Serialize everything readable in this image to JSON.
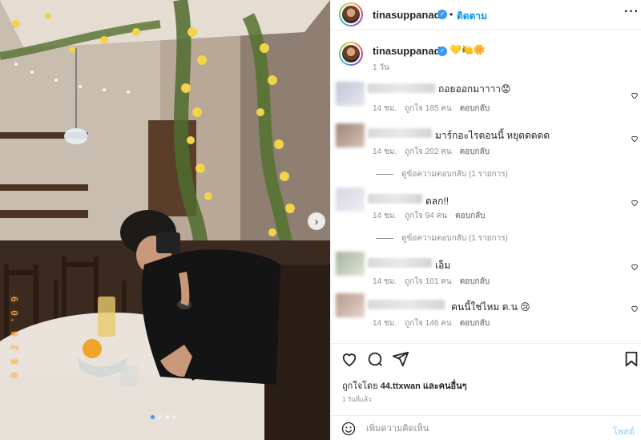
{
  "post": {
    "username": "tinasuppanad",
    "follow_label": "ติดตาม",
    "separator": "•",
    "more_icon": "more-horizontal-icon",
    "caption_emoji": "💛🍋🌼",
    "caption_time": "1 วัน",
    "photo_date_stamp": "0 8 2 8 '0 9",
    "carousel_count": 4,
    "carousel_active_index": 0
  },
  "comments": [
    {
      "text": "ถอยออกมาาาา😟",
      "time": "14 ชม.",
      "likes": "ถูกใจ 185 คน",
      "reply": "ตอบกลับ",
      "view_replies": ""
    },
    {
      "text": "มาร์กอะไรตอนนี้ หยุดดดดด",
      "time": "14 ชม.",
      "likes": "ถูกใจ 202 คน",
      "reply": "ตอบกลับ",
      "view_replies": "ดูข้อความตอบกลับ (1 รายการ)"
    },
    {
      "text": "ตลก!!",
      "time": "14 ชม.",
      "likes": "ถูกใจ 94 คน",
      "reply": "ตอบกลับ",
      "view_replies": "ดูข้อความตอบกลับ (1 รายการ)"
    },
    {
      "text": "เอ็ม",
      "time": "14 ชม.",
      "likes": "ถูกใจ 101 คน",
      "reply": "ตอบกลับ",
      "view_replies": ""
    },
    {
      "text": "คนนี้ใช่ไหม ต.น 😢",
      "time": "14 ชม.",
      "likes": "ถูกใจ 146 คน",
      "reply": "ตอบกลับ",
      "view_replies": ""
    }
  ],
  "footer": {
    "liked_by_prefix": "ถูกใจโดย",
    "liked_by_user": "44.ttxwan",
    "liked_by_suffix": "และคนอื่นๆ",
    "post_time": "1 วันที่แล้ว",
    "comment_placeholder": "เพิ่มความคิดเห็น",
    "post_label": "โพสต์"
  },
  "colors": {
    "accent": "#0095f6",
    "verified": "#3897f0",
    "muted": "#8e8e8e",
    "post_disabled": "#b2dffc"
  }
}
